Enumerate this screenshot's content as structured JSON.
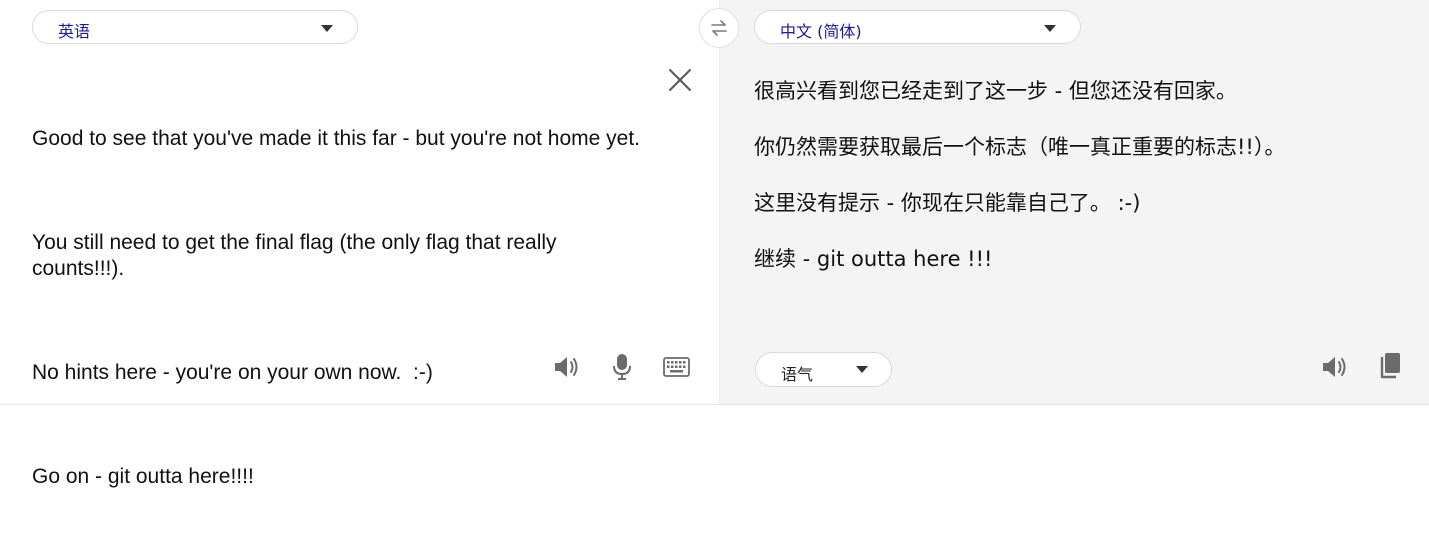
{
  "source": {
    "language": "英语",
    "paragraphs": [
      "Good to see that you've made it this far - but you're not home yet.",
      "You still need to get the final flag (the only flag that really counts!!!).",
      "No hints here - you're on your own now.  :-)",
      "Go on - git outta here!!!!"
    ]
  },
  "target": {
    "language": "中文 (简体)",
    "paragraphs": [
      "很高兴看到您已经走到了这一步 - 但您还没有回家。",
      "你仍然需要获取最后一个标志（唯一真正重要的标志!!）。",
      "这里没有提示 - 你现在只能靠自己了。 :-)",
      "继续 - git outta here !!!"
    ],
    "tone": "语气"
  },
  "icons": {
    "swap": "swap-arrows-icon",
    "clear": "close-icon",
    "source_speaker": "speaker-icon",
    "microphone": "microphone-icon",
    "keyboard": "keyboard-icon",
    "target_speaker": "speaker-icon",
    "copy": "copy-icon"
  },
  "colors": {
    "language_label": "#1a1a9a",
    "icon_gray": "#6b6b6b",
    "target_panel_bg": "#f4f4f4"
  }
}
